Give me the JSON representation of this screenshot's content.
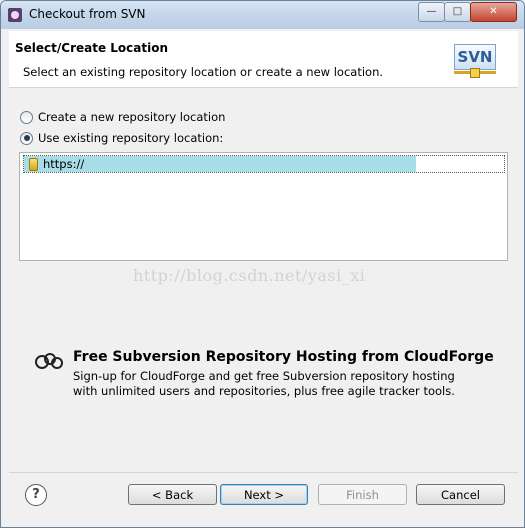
{
  "window": {
    "title": "Checkout from SVN"
  },
  "header": {
    "title": "Select/Create Location",
    "subtitle": "Select an existing repository location or create a new location.",
    "logo_text": "SVN"
  },
  "options": {
    "create_new_label": "Create a new repository location",
    "use_existing_label": "Use existing repository location:",
    "selected": "use_existing"
  },
  "repositories": [
    {
      "url": "https://"
    }
  ],
  "watermark": "http://blog.csdn.net/yasi_xi",
  "promo": {
    "title": "Free Subversion Repository Hosting from CloudForge",
    "line1": "Sign-up for CloudForge and get free Subversion repository hosting",
    "line2": "with unlimited users and repositories, plus free agile tracker tools."
  },
  "buttons": {
    "help": "?",
    "back": "< Back",
    "next": "Next >",
    "finish": "Finish",
    "cancel": "Cancel"
  },
  "colors": {
    "selection": "#a8dce6",
    "titlebar": "#c4d6ea"
  }
}
